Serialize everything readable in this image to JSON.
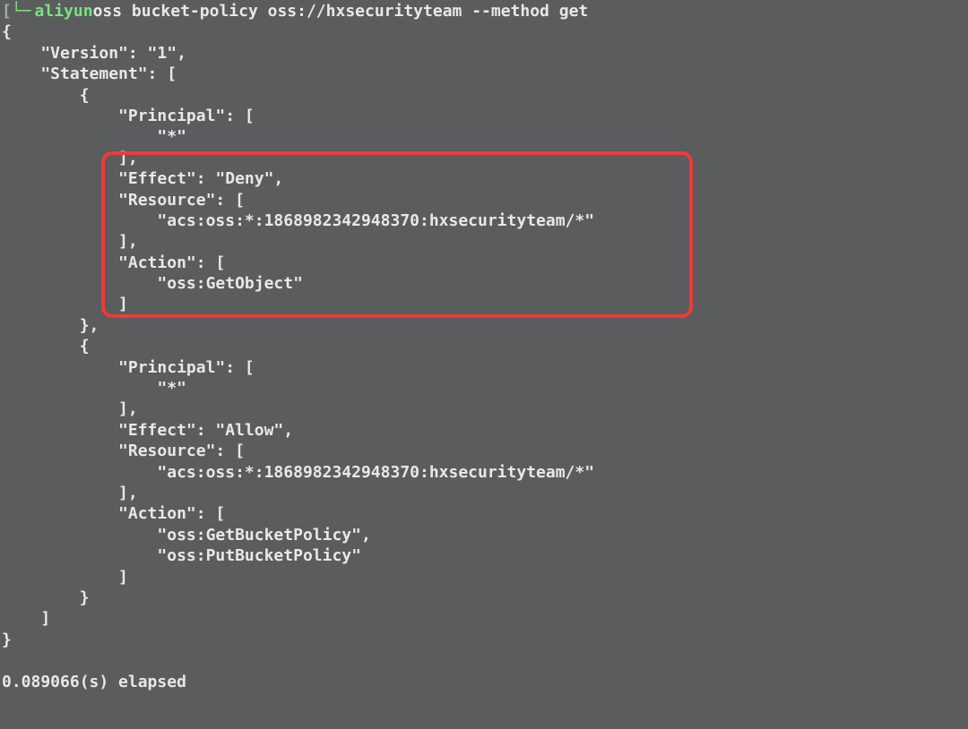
{
  "prompt": {
    "arrow_char": "⟶",
    "command_name": "aliyun",
    "command_args": " oss bucket-policy oss://hxsecurityteam --method get"
  },
  "output": {
    "Version": "1",
    "Statement": [
      {
        "Principal": [
          "*"
        ],
        "Effect": "Deny",
        "Resource": [
          "acs:oss:*:1868982342948370:hxsecurityteam/*"
        ],
        "Action": [
          "oss:GetObject"
        ]
      },
      {
        "Principal": [
          "*"
        ],
        "Effect": "Allow",
        "Resource": [
          "acs:oss:*:1868982342948370:hxsecurityteam/*"
        ],
        "Action": [
          "oss:GetBucketPolicy",
          "oss:PutBucketPolicy"
        ]
      }
    ]
  },
  "json_lines": [
    "{",
    "    \"Version\": \"1\",",
    "    \"Statement\": [",
    "        {",
    "            \"Principal\": [",
    "                \"*\"",
    "            ],",
    "            \"Effect\": \"Deny\",",
    "            \"Resource\": [",
    "                \"acs:oss:*:1868982342948370:hxsecurityteam/*\"",
    "            ],",
    "            \"Action\": [",
    "                \"oss:GetObject\"",
    "            ]",
    "        },",
    "        {",
    "            \"Principal\": [",
    "                \"*\"",
    "            ],",
    "            \"Effect\": \"Allow\",",
    "            \"Resource\": [",
    "                \"acs:oss:*:1868982342948370:hxsecurityteam/*\"",
    "            ],",
    "            \"Action\": [",
    "                \"oss:GetBucketPolicy\",",
    "                \"oss:PutBucketPolicy\"",
    "            ]",
    "        }",
    "    ]",
    "}"
  ],
  "elapsed_text": "0.089066(s) elapsed",
  "highlight": {
    "start_line_index": 7,
    "end_line_index": 13,
    "description": "Deny GetObject policy block"
  }
}
